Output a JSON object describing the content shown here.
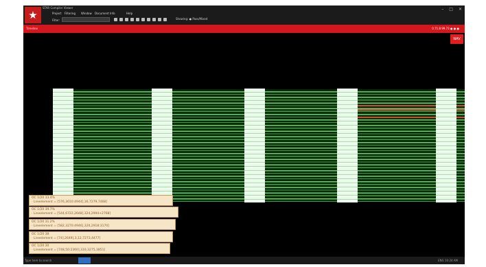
{
  "window": {
    "title": "STAR Compiler Viewer",
    "minimize": "–",
    "maximize": "□",
    "close": "✕"
  },
  "menu": [
    "Project",
    "Filtering",
    "Window",
    "Document Info",
    "Help"
  ],
  "toolbar": {
    "search_label": "Filter:",
    "search_placeholder": "",
    "status_text": "Showing: ● Pass/Mixed"
  },
  "header": {
    "title": "Timeline",
    "right_text": "0.71.8 99.73 ● ● ●"
  },
  "nav_badge": "NAV",
  "tooltips": [
    {
      "line1": "OC 1/20 33.4%",
      "line2": "· Lineelement = [576,3010:4944],16,7279,7468]"
    },
    {
      "line1": "OC 1/20 39.7%",
      "line2": "· Lineelement = [544,6722,2648],324,2994+2768]"
    },
    {
      "line1": "OC 1/20 31.2%",
      "line2": "· Lineelement = [582,3270:4946],320,2918:3170]"
    },
    {
      "line1": "OC 1/20 38",
      "line2": "· Lineelement = [74],2649],3,12,7273,4477]"
    },
    {
      "line1": "OC 1/20 30",
      "line2": "· Lineelement = [748,50:2360],310,3275,3851]"
    }
  ],
  "taskbar": {
    "left_text": "Type here to search",
    "right_text": "ENG 10:24 AM"
  },
  "colors": {
    "accent": "#d4161d",
    "column": "#f2fff2",
    "band": "#4ca84c",
    "tooltip_bg": "#f7e5c8",
    "highlight": "#c85030"
  }
}
